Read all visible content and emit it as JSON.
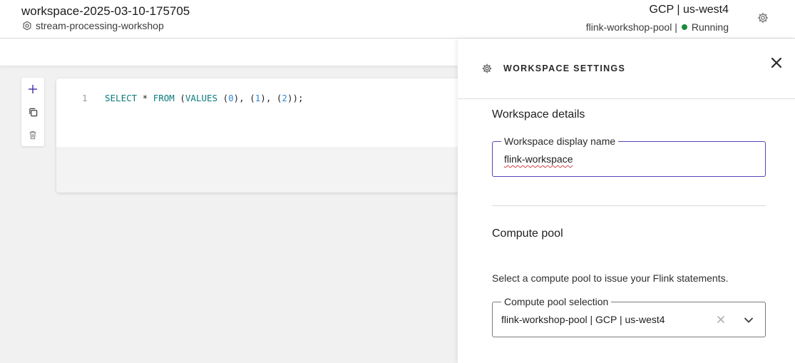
{
  "header": {
    "workspace_name": "workspace-2025-03-10-175705",
    "environment": "stream-processing-workshop",
    "region": "GCP | us-west4",
    "pool": "flink-workshop-pool |",
    "status": "Running",
    "status_color": "#1e8a3c"
  },
  "cell_actions": [
    "add-cell-icon",
    "copy-cell-icon",
    "delete-cell-icon"
  ],
  "editor": {
    "line_number": "1",
    "code": "SELECT * FROM (VALUES (0), (1), (2));"
  },
  "settings_panel": {
    "title": "WORKSPACE SETTINGS",
    "details_heading": "Workspace details",
    "display_name_label": "Workspace display name",
    "display_name_value": "flink-workspace",
    "compute_heading": "Compute pool",
    "compute_help": "Select a compute pool to issue your Flink statements.",
    "pool_label": "Compute pool selection",
    "pool_value": "flink-workshop-pool | GCP | us-west4",
    "accent_color": "#5a43b8"
  }
}
